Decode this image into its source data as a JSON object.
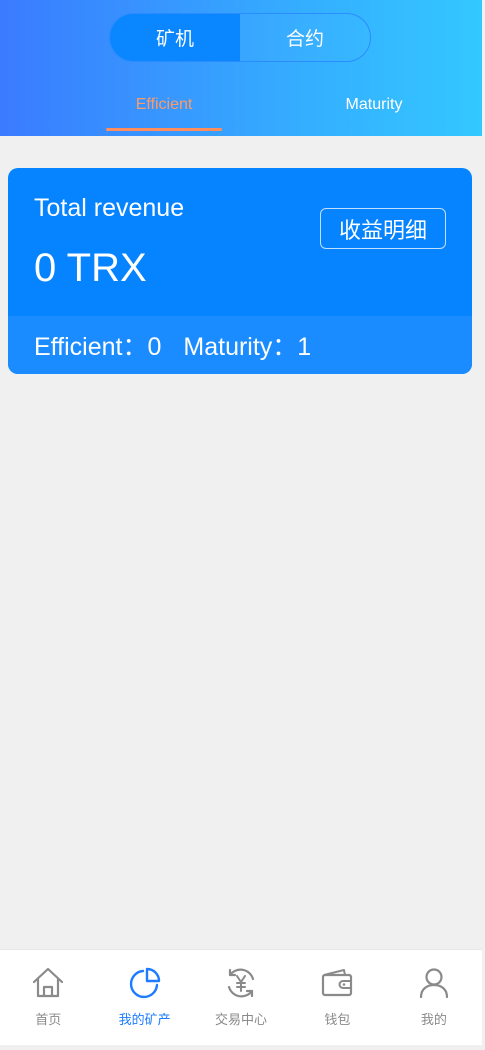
{
  "header": {
    "segments": [
      "矿机",
      "合约"
    ],
    "active_segment": 0,
    "tabs": [
      "Efficient",
      "Maturity"
    ],
    "active_tab": 0
  },
  "card": {
    "title": "Total revenue",
    "amount": "0 TRX",
    "detail_button": "收益明细",
    "efficient_text": "Efficient：0",
    "maturity_text": "Maturity：1"
  },
  "nav": {
    "items": [
      {
        "label": "首页",
        "icon": "home-icon"
      },
      {
        "label": "我的矿产",
        "icon": "pie-chart-icon"
      },
      {
        "label": "交易中心",
        "icon": "exchange-yen-icon"
      },
      {
        "label": "钱包",
        "icon": "wallet-icon"
      },
      {
        "label": "我的",
        "icon": "user-icon"
      }
    ],
    "active_index": 1
  },
  "colors": {
    "primary": "#0683ff",
    "active_tab": "#ff8e5c",
    "nav_active": "#1d7cff",
    "nav_inactive": "#8a8a8a"
  }
}
